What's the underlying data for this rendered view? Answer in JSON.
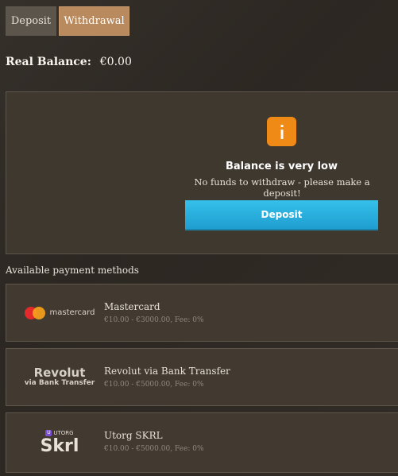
{
  "tabs": {
    "deposit": "Deposit",
    "withdrawal": "Withdrawal"
  },
  "balance": {
    "label": "Real Balance:",
    "value": "€0.00"
  },
  "notice": {
    "icon": "info-icon",
    "icon_glyph": "i",
    "title": "Balance is very low",
    "message": "No funds to withdraw - please make a deposit!",
    "button": "Deposit"
  },
  "methods_label": "Available payment methods",
  "methods": [
    {
      "logo_text": "mastercard",
      "name": "Mastercard",
      "range": "€10.00 - €3000.00, Fee: 0%"
    },
    {
      "logo_text": "Revolut",
      "logo_sub": "via Bank Transfer",
      "name": "Revolut via Bank Transfer",
      "range": "€10.00 - €5000.00, Fee: 0%"
    },
    {
      "logo_top": "UTORG",
      "logo_text": "Skrl",
      "name": "Utorg SKRL",
      "range": "€10.00 - €5000.00, Fee: 0%"
    }
  ],
  "colors": {
    "accent_tab": "#b98a5e",
    "button": "#2bb3e0",
    "info": "#f08a16"
  }
}
